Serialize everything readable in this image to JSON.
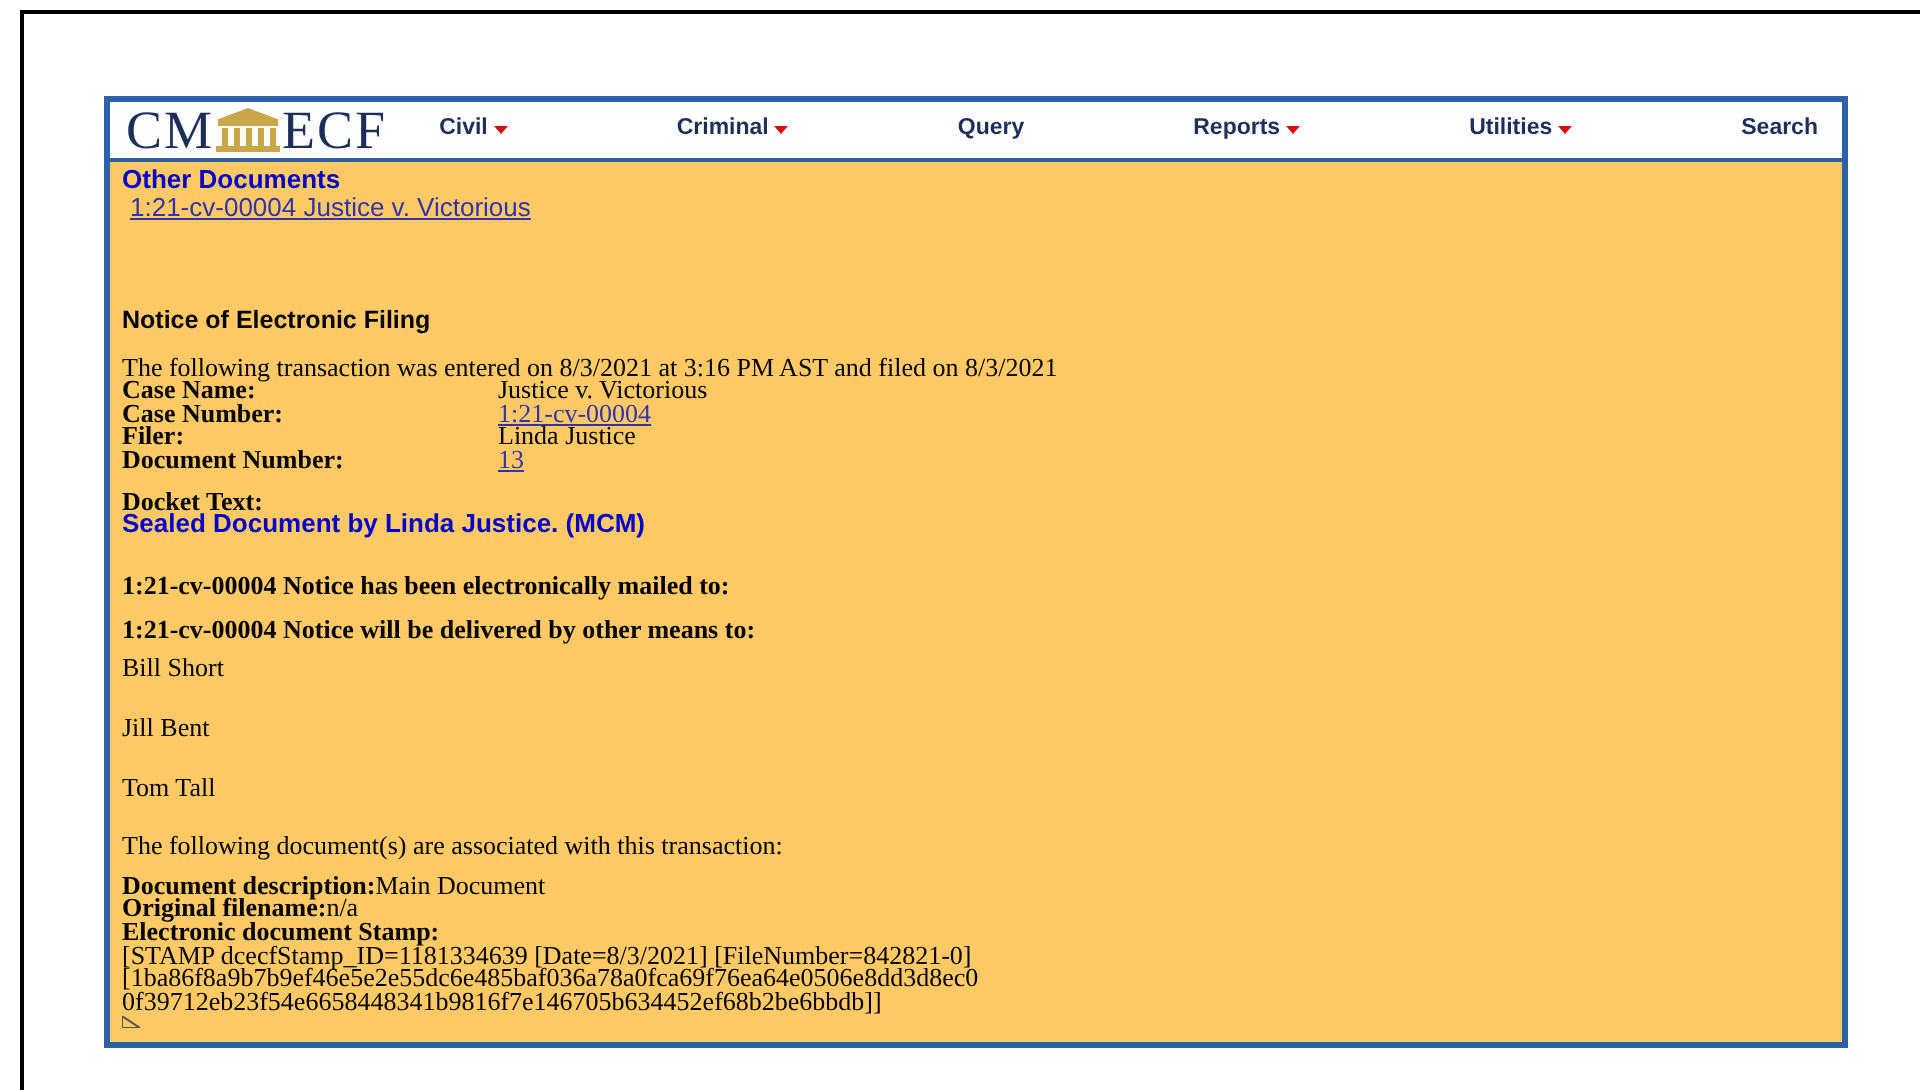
{
  "header": {
    "logo": {
      "left": "CM",
      "right": "ECF"
    },
    "menu": [
      {
        "label": "Civil",
        "dropdown": true
      },
      {
        "label": "Criminal",
        "dropdown": true
      },
      {
        "label": "Query",
        "dropdown": false
      },
      {
        "label": "Reports",
        "dropdown": true
      },
      {
        "label": "Utilities",
        "dropdown": true
      },
      {
        "label": "Search",
        "dropdown": false
      }
    ]
  },
  "other_documents": {
    "title": "Other Documents",
    "link": "1:21-cv-00004 Justice v. Victorious"
  },
  "notice": {
    "title": "Notice of Electronic Filing",
    "intro": "The following transaction was entered on 8/3/2021 at 3:16 PM AST and filed on 8/3/2021",
    "fields": [
      {
        "label": "Case Name:",
        "value": "Justice v. Victorious",
        "kind": "text"
      },
      {
        "label": "Case Number:",
        "value": "1:21-cv-00004",
        "kind": "link"
      },
      {
        "label": "Filer:",
        "value": "Linda Justice",
        "kind": "text"
      },
      {
        "label": "Document Number:",
        "value": "13",
        "kind": "link"
      }
    ],
    "docket_label": "Docket Text:",
    "docket_text": "Sealed Document by Linda Justice. (MCM)",
    "mailed_heading": "1:21-cv-00004 Notice has been electronically mailed to:",
    "other_heading": "1:21-cv-00004 Notice will be delivered by other means to:",
    "recipients": [
      "Bill Short",
      "Jill Bent",
      "Tom Tall"
    ],
    "documents_intro": "The following document(s) are associated with this transaction:",
    "document_fields": [
      {
        "label": "Document description:",
        "value": "Main Document"
      },
      {
        "label": "Original filename:",
        "value": "n/a"
      },
      {
        "label": "Electronic document Stamp:"
      }
    ],
    "stamp_lines": [
      "[STAMP dcecfStamp_ID=1181334639 [Date=8/3/2021] [FileNumber=842821-0]",
      "[1ba86f8a9b7b9ef46e5e2e55dc6e485baf036a78a0fca69f76ea64e0506e8dd3d8ec0",
      "0f39712eb23f54e6658448341b9816f7e146705b634452ef68b2be6bbdb]]"
    ]
  }
}
